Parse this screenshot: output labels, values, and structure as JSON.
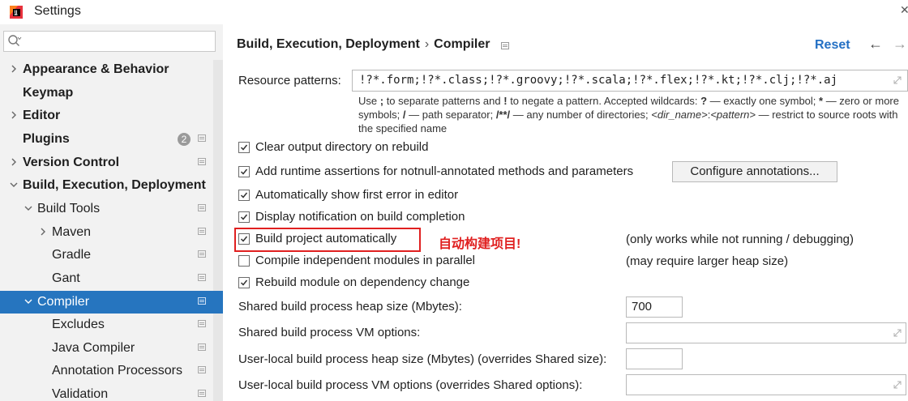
{
  "window": {
    "title": "Settings"
  },
  "search": {
    "placeholder": "Q▾"
  },
  "sidebar": {
    "items": [
      {
        "label": "Appearance & Behavior",
        "arrow": "right",
        "bold": true
      },
      {
        "label": "Keymap",
        "arrow": "none",
        "bold": true
      },
      {
        "label": "Editor",
        "arrow": "right",
        "bold": true
      },
      {
        "label": "Plugins",
        "arrow": "none",
        "bold": true,
        "badge": "2"
      },
      {
        "label": "Version Control",
        "arrow": "right",
        "bold": true
      },
      {
        "label": "Build, Execution, Deployment",
        "arrow": "down",
        "bold": true
      },
      {
        "label": "Build Tools",
        "arrow": "down",
        "bold": false
      },
      {
        "label": "Maven",
        "arrow": "right",
        "bold": false
      },
      {
        "label": "Gradle",
        "arrow": "none",
        "bold": false
      },
      {
        "label": "Gant",
        "arrow": "none",
        "bold": false
      },
      {
        "label": "Compiler",
        "arrow": "down",
        "bold": false,
        "selected": true
      },
      {
        "label": "Excludes",
        "arrow": "none",
        "bold": false
      },
      {
        "label": "Java Compiler",
        "arrow": "none",
        "bold": false
      },
      {
        "label": "Annotation Processors",
        "arrow": "none",
        "bold": false
      },
      {
        "label": "Validation",
        "arrow": "none",
        "bold": false
      }
    ]
  },
  "header": {
    "crumb_parent": "Build, Execution, Deployment",
    "crumb_separator": "›",
    "crumb_current": "Compiler",
    "reset": "Reset",
    "back_arrow": "←",
    "forward_arrow": "→"
  },
  "resource_patterns": {
    "label": "Resource patterns:",
    "value": "!?*.form;!?*.class;!?*.groovy;!?*.scala;!?*.flex;!?*.kt;!?*.clj;!?*.aj",
    "help": {
      "t1": "Use ",
      "semicolon": ";",
      "t2": " to separate patterns and ",
      "bang": "!",
      "t3": " to negate a pattern. Accepted wildcards: ",
      "q": "?",
      "t4": " — exactly one symbol; ",
      "star": "*",
      "t5": " — zero or more symbols; ",
      "slash": "/",
      "t6": " — path separator; ",
      "dstar": "/**/",
      "t7": " — any number of directories; ",
      "dir": "<dir_name>",
      "colon": ":",
      "pat": "<pattern>",
      "t8": " — restrict to source roots with the specified name"
    }
  },
  "options": {
    "clear_output": {
      "label": "Clear output directory on rebuild",
      "checked": true
    },
    "add_assertions": {
      "label": "Add runtime assertions for notnull-annotated methods and parameters",
      "checked": true
    },
    "configure_annotations": "Configure annotations...",
    "show_first_error": {
      "label": "Automatically show first error in editor",
      "checked": true
    },
    "display_notification": {
      "label": "Display notification on build completion",
      "checked": true
    },
    "build_automatically": {
      "label": "Build project automatically",
      "checked": true,
      "annotation": "自动构建项目!",
      "note": "(only works while not running / debugging)"
    },
    "compile_parallel": {
      "label": "Compile independent modules in parallel",
      "checked": false,
      "note": "(may require larger heap size)"
    },
    "rebuild_module": {
      "label": "Rebuild module on dependency change",
      "checked": true
    }
  },
  "fields": {
    "heap_size": {
      "label": "Shared build process heap size (Mbytes):",
      "value": "700"
    },
    "vm_options": {
      "label": "Shared build process VM options:",
      "value": ""
    },
    "local_heap": {
      "label": "User-local build process heap size (Mbytes) (overrides Shared size):",
      "value": ""
    },
    "local_vm": {
      "label": "User-local build process VM options (overrides Shared options):",
      "value": ""
    }
  },
  "colors": {
    "accent": "#2675bf",
    "link": "#2470c4",
    "annotation": "#e02020"
  }
}
